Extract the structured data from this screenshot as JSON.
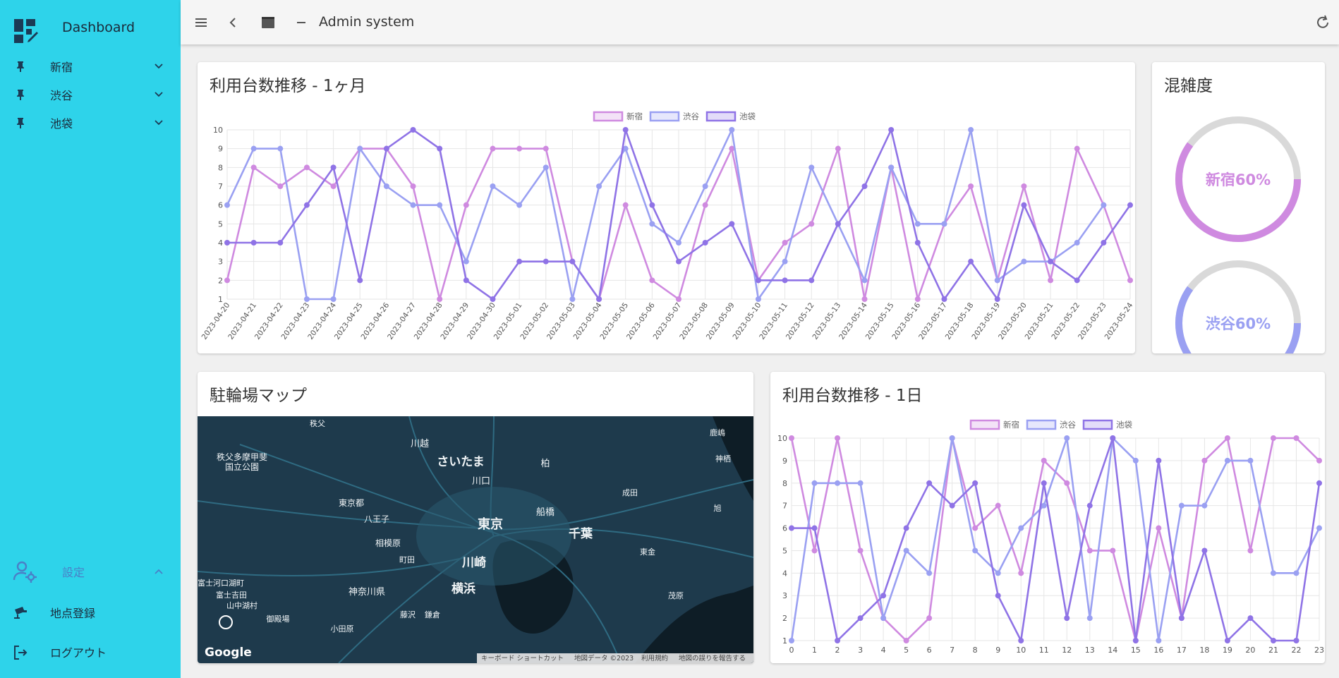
{
  "sidebar": {
    "brand_title": "Dashboard",
    "locations": [
      {
        "label": "新宿"
      },
      {
        "label": "渋谷"
      },
      {
        "label": "池袋"
      }
    ],
    "settings_label": "設定",
    "register_label": "地点登録",
    "logout_label": "ログアウト"
  },
  "topbar": {
    "title": "Admin system"
  },
  "colors": {
    "sidebar": "#2ed3ea",
    "shinjuku": "#cf8ae0",
    "shibuya": "#9aa0f2",
    "ikebukuro": "#8f73e6"
  },
  "monthly_card": {
    "title": "利用台数推移 - 1ヶ月"
  },
  "congestion_card": {
    "title": "混雑度",
    "gauges": [
      {
        "label": "新宿60%",
        "value": 60,
        "color": "#cf8ae0"
      },
      {
        "label": "渋谷60%",
        "value": 60,
        "color": "#9aa0f2"
      }
    ]
  },
  "map_card": {
    "title": "駐輪場マップ",
    "places": [
      "秩父",
      "川越",
      "さいたま",
      "柏",
      "鹿嶋",
      "秩父多摩甲斐",
      "国立公園",
      "川口",
      "神栖",
      "東京都",
      "成田",
      "八王子",
      "船橋",
      "東京",
      "千葉",
      "旭",
      "相模原",
      "東金",
      "町田",
      "川崎",
      "富士河口湖町",
      "富士吉田",
      "山中湖村",
      "神奈川県",
      "横浜",
      "茂原",
      "御殿場",
      "藤沢",
      "鎌倉",
      "小田原"
    ],
    "google_logo": "Google",
    "footer": [
      "キーボード ショートカット",
      "地図データ ©2023",
      "利用規約",
      "地図の誤りを報告する"
    ]
  },
  "daily_card": {
    "title": "利用台数推移 - 1日"
  },
  "chart_data": [
    {
      "type": "line",
      "legend_position": "top",
      "x": [
        "2023-04-20",
        "2023-04-21",
        "2023-04-22",
        "2023-04-23",
        "2023-04-24",
        "2023-04-25",
        "2023-04-26",
        "2023-04-27",
        "2023-04-28",
        "2023-04-29",
        "2023-04-30",
        "2023-05-01",
        "2023-05-02",
        "2023-05-03",
        "2023-05-04",
        "2023-05-05",
        "2023-05-06",
        "2023-05-07",
        "2023-05-08",
        "2023-05-09",
        "2023-05-10",
        "2023-05-11",
        "2023-05-12",
        "2023-05-13",
        "2023-05-14",
        "2023-05-15",
        "2023-05-16",
        "2023-05-17",
        "2023-05-18",
        "2023-05-19",
        "2023-05-20",
        "2023-05-21",
        "2023-05-22",
        "2023-05-23",
        "2023-05-24"
      ],
      "ylim": [
        1,
        10
      ],
      "yticks": [
        1,
        2,
        3,
        4,
        5,
        6,
        7,
        8,
        9,
        10
      ],
      "grid": true,
      "series": [
        {
          "name": "新宿",
          "color": "#cf8ae0",
          "values": [
            2,
            8,
            7,
            8,
            7,
            9,
            9,
            7,
            1,
            6,
            9,
            9,
            9,
            3,
            1,
            6,
            2,
            1,
            6,
            9,
            2,
            4,
            5,
            9,
            1,
            8,
            1,
            5,
            7,
            2,
            7,
            2,
            9,
            6,
            2
          ]
        },
        {
          "name": "渋谷",
          "color": "#9aa0f2",
          "values": [
            6,
            9,
            9,
            1,
            1,
            9,
            7,
            6,
            6,
            3,
            7,
            6,
            8,
            1,
            7,
            9,
            5,
            4,
            7,
            10,
            1,
            3,
            8,
            5,
            2,
            8,
            5,
            5,
            10,
            2,
            3,
            3,
            4,
            6,
            null
          ]
        },
        {
          "name": "池袋",
          "color": "#8f73e6",
          "values": [
            4,
            4,
            4,
            6,
            8,
            2,
            9,
            10,
            9,
            2,
            1,
            3,
            3,
            3,
            1,
            10,
            6,
            3,
            4,
            5,
            2,
            2,
            2,
            5,
            7,
            10,
            4,
            1,
            3,
            1,
            6,
            3,
            2,
            4,
            6
          ]
        }
      ]
    },
    {
      "type": "line",
      "legend_position": "top",
      "x": [
        "0",
        "1",
        "2",
        "3",
        "4",
        "5",
        "6",
        "7",
        "8",
        "9",
        "10",
        "11",
        "12",
        "13",
        "14",
        "15",
        "16",
        "17",
        "18",
        "19",
        "20",
        "21",
        "22",
        "23"
      ],
      "ylim": [
        1,
        10
      ],
      "yticks": [
        1,
        2,
        3,
        4,
        5,
        6,
        7,
        8,
        9,
        10
      ],
      "grid": true,
      "series": [
        {
          "name": "新宿",
          "color": "#cf8ae0",
          "values": [
            10,
            5,
            10,
            5,
            2,
            1,
            2,
            10,
            6,
            7,
            4,
            9,
            8,
            5,
            5,
            1,
            6,
            2,
            9,
            10,
            5,
            10,
            10,
            9
          ]
        },
        {
          "name": "渋谷",
          "color": "#9aa0f2",
          "values": [
            1,
            8,
            8,
            8,
            2,
            5,
            4,
            10,
            5,
            4,
            6,
            7,
            10,
            2,
            10,
            9,
            1,
            7,
            7,
            9,
            9,
            4,
            4,
            6
          ]
        },
        {
          "name": "池袋",
          "color": "#8f73e6",
          "values": [
            6,
            6,
            1,
            2,
            3,
            6,
            8,
            7,
            8,
            3,
            1,
            8,
            2,
            7,
            10,
            1,
            9,
            2,
            5,
            1,
            2,
            1,
            1,
            8
          ]
        }
      ]
    }
  ]
}
